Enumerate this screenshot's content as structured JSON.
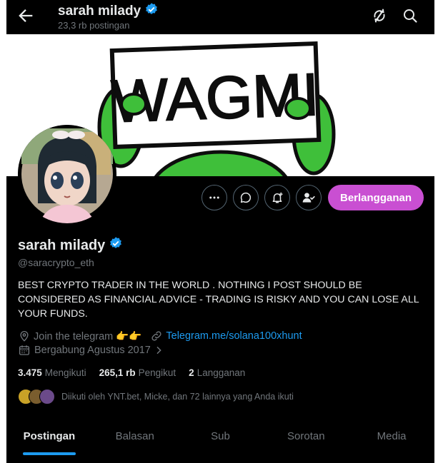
{
  "header": {
    "title": "sarah milady",
    "post_count": "23,3 rb postingan"
  },
  "banner": {
    "sign_text": "WAGMI"
  },
  "profile": {
    "name": "sarah milady",
    "handle": "@saracrypto_eth",
    "bio": "BEST CRYPTO TRADER IN THE WORLD . NOTHING I POST SHOULD BE CONSIDERED AS FINANCIAL ADVICE - TRADING IS RISKY AND YOU CAN LOSE ALL YOUR FUNDS.",
    "location": "Join the telegram 👉👉",
    "website": "Telegram.me/solana100xhunt",
    "joined": "Bergabung Agustus 2017",
    "subscribe_label": "Berlangganan"
  },
  "stats": {
    "following_count": "3.475",
    "following_label": "Mengikuti",
    "followers_count": "265,1 rb",
    "followers_label": "Pengikut",
    "subs_count": "2",
    "subs_label": "Langganan"
  },
  "followed_by": "Diikuti oleh YNT.bet, Micke, dan 72 lainnya yang Anda ikuti",
  "tabs": [
    "Postingan",
    "Balasan",
    "Sub",
    "Sorotan",
    "Media"
  ],
  "active_tab": "Postingan",
  "colors": {
    "accent": "#1d9bf0",
    "subscribe": "#c94fd2",
    "background": "#000000",
    "muted": "#71767b"
  },
  "icons": [
    "back-arrow-icon",
    "verified-badge-icon",
    "refresh-icon",
    "search-icon",
    "more-icon",
    "message-icon",
    "notification-bell-icon",
    "following-user-icon",
    "location-icon",
    "link-icon",
    "calendar-icon",
    "chevron-right-icon"
  ]
}
